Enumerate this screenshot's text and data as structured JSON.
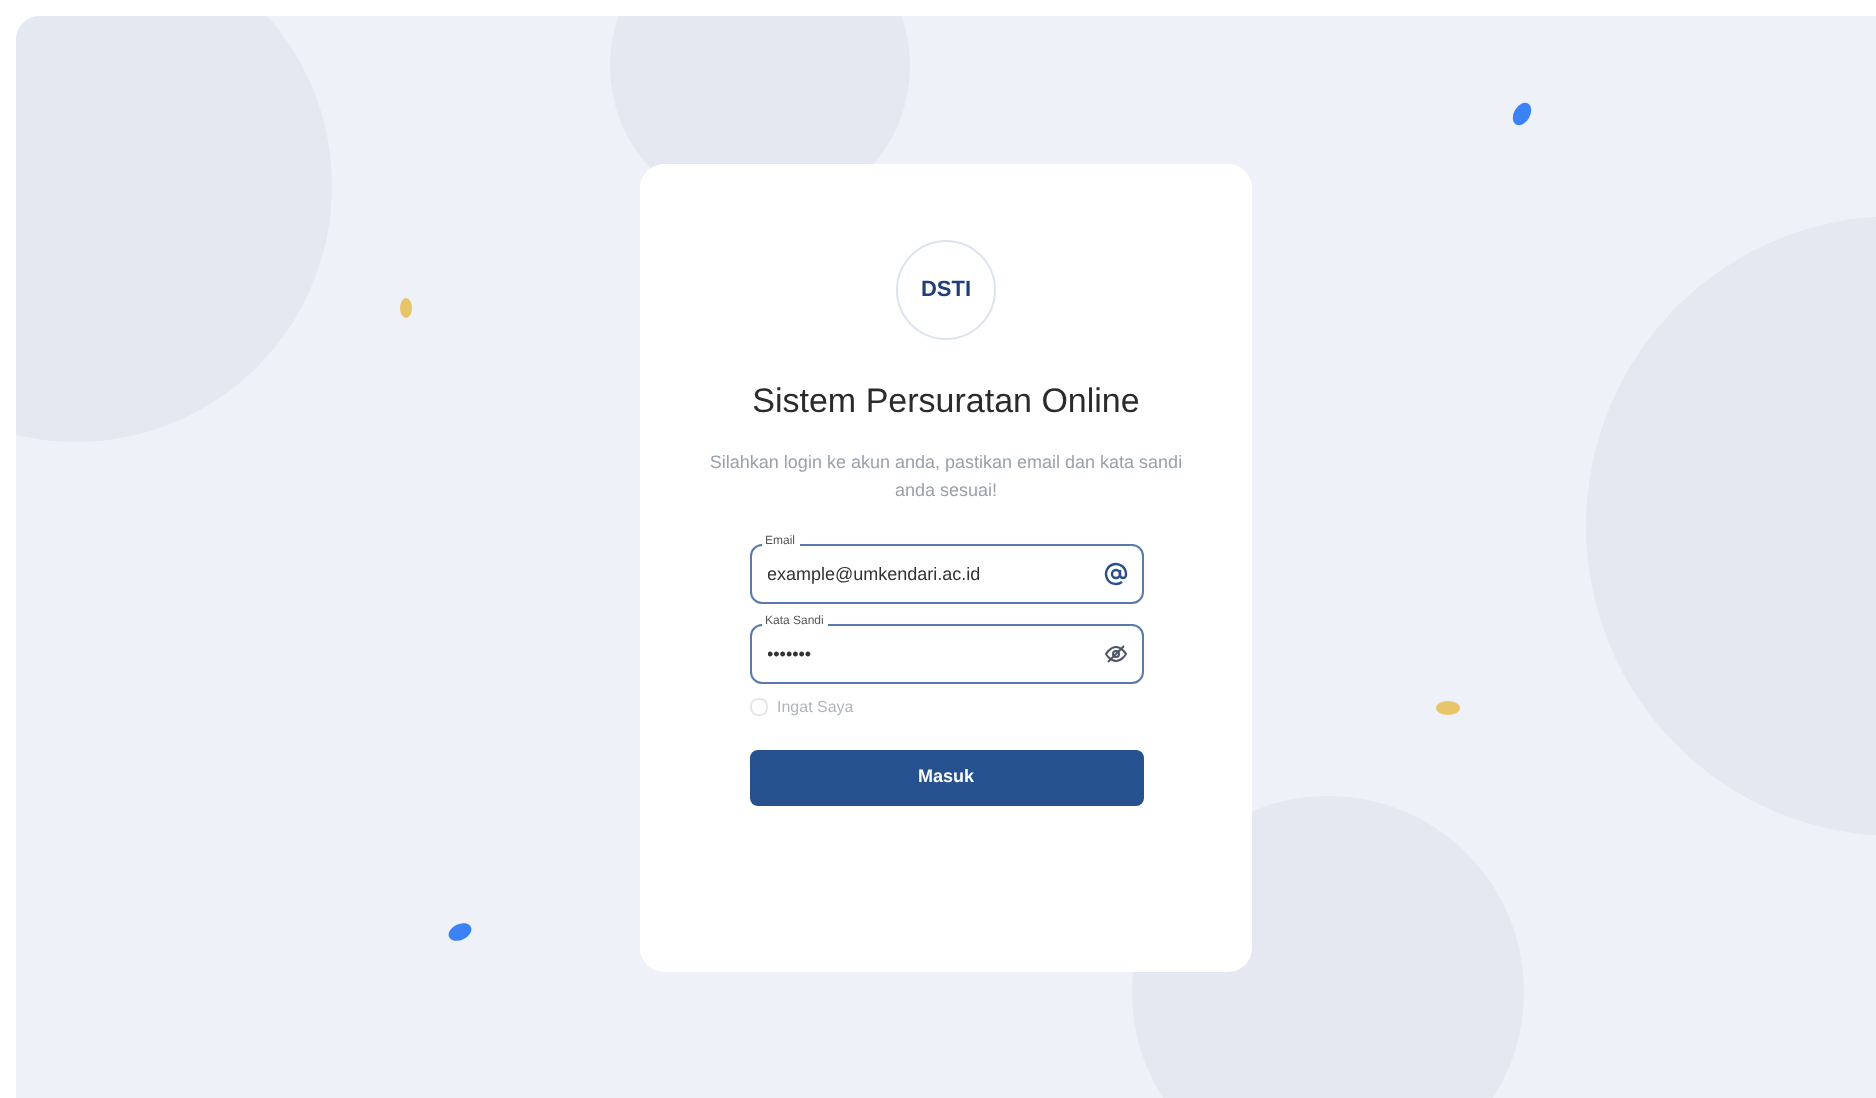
{
  "logo": {
    "text": "DSTI"
  },
  "title": "Sistem Persuratan Online",
  "subtitle": "Silahkan login ke akun anda, pastikan email dan kata sandi anda sesuai!",
  "fields": [
    {
      "kind": "email",
      "label": "Email",
      "value": "example@umkendari.ac.id"
    },
    {
      "kind": "password",
      "label": "Kata Sandi",
      "value": "•••••••"
    }
  ],
  "remember": {
    "label": "Ingat Saya",
    "checked": false
  },
  "submit": "Masuk"
}
